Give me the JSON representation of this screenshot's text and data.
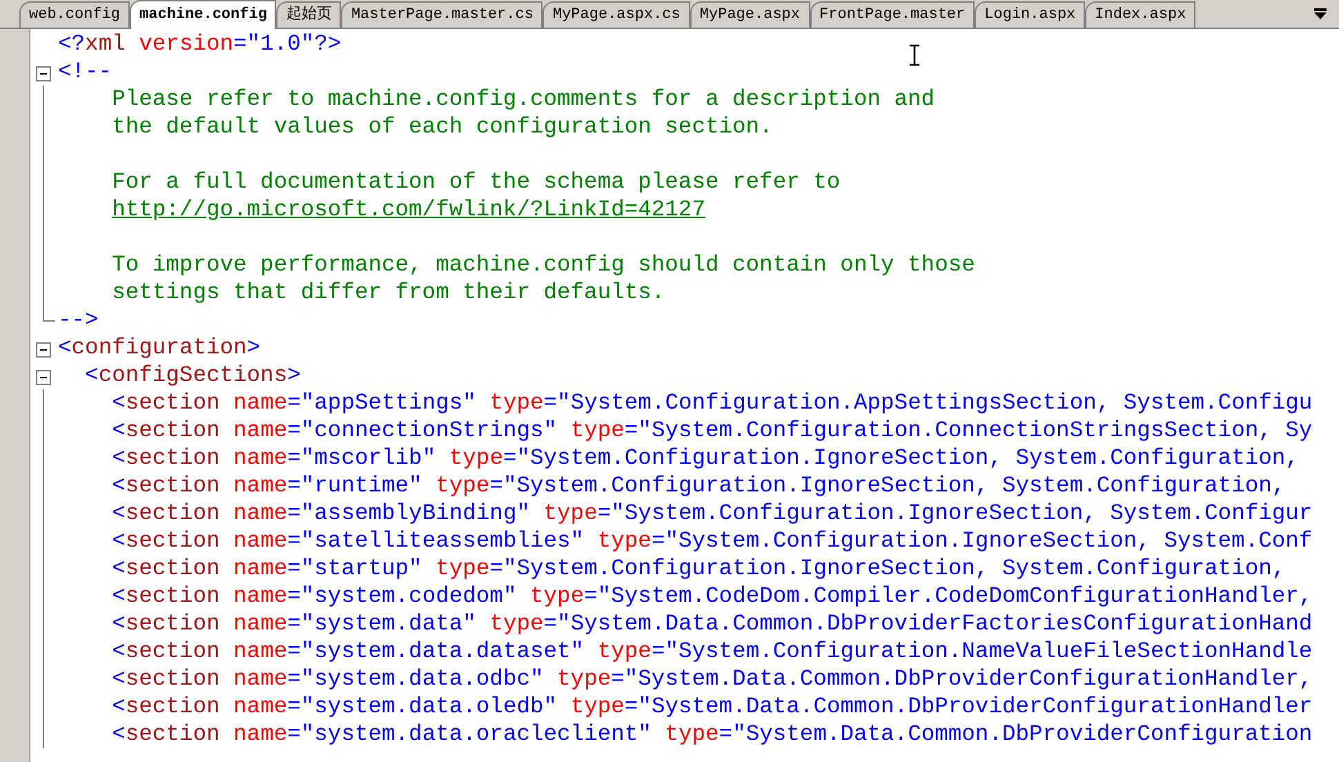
{
  "tabs": [
    {
      "label": "web.config",
      "selected": false
    },
    {
      "label": "machine.config",
      "selected": true
    },
    {
      "label": "起始页",
      "selected": false
    },
    {
      "label": "MasterPage.master.cs",
      "selected": false
    },
    {
      "label": "MyPage.aspx.cs",
      "selected": false
    },
    {
      "label": "MyPage.aspx",
      "selected": false
    },
    {
      "label": "FrontPage.master",
      "selected": false
    },
    {
      "label": "Login.aspx",
      "selected": false
    },
    {
      "label": "Index.aspx",
      "selected": false
    }
  ],
  "lines": [
    {
      "tokens": [
        {
          "kind": "bracket",
          "text": "<?"
        },
        {
          "kind": "tag",
          "text": "xml"
        },
        {
          "kind": "attr",
          "text": " version"
        },
        {
          "kind": "value",
          "text": "=\"1.0\""
        },
        {
          "kind": "bracket",
          "text": "?>"
        }
      ]
    },
    {
      "collapse_box": true,
      "tokens": [
        {
          "kind": "bracket",
          "text": "<!--"
        }
      ]
    },
    {
      "fold_line": true,
      "tokens": [
        {
          "kind": "comment",
          "text": "    Please refer to machine.config.comments for a description and"
        }
      ]
    },
    {
      "fold_line": true,
      "tokens": [
        {
          "kind": "comment",
          "text": "    the default values of each configuration section."
        }
      ]
    },
    {
      "fold_line": true
    },
    {
      "fold_line": true,
      "tokens": [
        {
          "kind": "comment",
          "text": "    For a full documentation of the schema please refer to"
        }
      ]
    },
    {
      "fold_line": true,
      "tokens": [
        {
          "kind": "link",
          "text": "http://go.microsoft.com/fwlink/?LinkId=42127"
        }
      ]
    },
    {
      "fold_line": true
    },
    {
      "fold_line": true,
      "tokens": [
        {
          "kind": "comment",
          "text": "    To improve performance, machine.config should contain only those"
        }
      ]
    },
    {
      "fold_line": true,
      "tokens": [
        {
          "kind": "comment",
          "text": "    settings that differ from their defaults."
        }
      ]
    },
    {
      "fold_end": true,
      "tokens": [
        {
          "kind": "bracket",
          "text": "-->"
        }
      ]
    },
    {
      "collapse_box": true,
      "tokens": [
        {
          "kind": "bracket",
          "text": "<"
        },
        {
          "kind": "tag",
          "text": "configuration"
        },
        {
          "kind": "bracket",
          "text": ">"
        }
      ]
    },
    {
      "collapse_box": true,
      "tokens": [
        {
          "kind": "bracket",
          "text": "  <"
        },
        {
          "kind": "tag",
          "text": "configSections"
        },
        {
          "kind": "bracket",
          "text": ">"
        }
      ]
    },
    {
      "fold_line": true,
      "tokens": [
        {
          "kind": "bracket",
          "text": "    <"
        },
        {
          "kind": "tag",
          "text": "section"
        },
        {
          "kind": "attr",
          "text": " name"
        },
        {
          "kind": "value",
          "text": "=\"appSettings\""
        },
        {
          "kind": "attr",
          "text": " type"
        },
        {
          "kind": "value",
          "text": "=\"System.Configuration.AppSettingsSection, System.Configu"
        }
      ]
    },
    {
      "fold_line": true,
      "tokens": [
        {
          "kind": "bracket",
          "text": "    <"
        },
        {
          "kind": "tag",
          "text": "section"
        },
        {
          "kind": "attr",
          "text": " name"
        },
        {
          "kind": "value",
          "text": "=\"connectionStrings\""
        },
        {
          "kind": "attr",
          "text": " type"
        },
        {
          "kind": "value",
          "text": "=\"System.Configuration.ConnectionStringsSection, Sy"
        }
      ]
    },
    {
      "fold_line": true,
      "tokens": [
        {
          "kind": "bracket",
          "text": "    <"
        },
        {
          "kind": "tag",
          "text": "section"
        },
        {
          "kind": "attr",
          "text": " name"
        },
        {
          "kind": "value",
          "text": "=\"mscorlib\""
        },
        {
          "kind": "attr",
          "text": " type"
        },
        {
          "kind": "value",
          "text": "=\"System.Configuration.IgnoreSection, System.Configuration,"
        }
      ]
    },
    {
      "fold_line": true,
      "tokens": [
        {
          "kind": "bracket",
          "text": "    <"
        },
        {
          "kind": "tag",
          "text": "section"
        },
        {
          "kind": "attr",
          "text": " name"
        },
        {
          "kind": "value",
          "text": "=\"runtime\""
        },
        {
          "kind": "attr",
          "text": " type"
        },
        {
          "kind": "value",
          "text": "=\"System.Configuration.IgnoreSection, System.Configuration,"
        }
      ]
    },
    {
      "fold_line": true,
      "tokens": [
        {
          "kind": "bracket",
          "text": "    <"
        },
        {
          "kind": "tag",
          "text": "section"
        },
        {
          "kind": "attr",
          "text": " name"
        },
        {
          "kind": "value",
          "text": "=\"assemblyBinding\""
        },
        {
          "kind": "attr",
          "text": " type"
        },
        {
          "kind": "value",
          "text": "=\"System.Configuration.IgnoreSection, System.Configur"
        }
      ]
    },
    {
      "fold_line": true,
      "tokens": [
        {
          "kind": "bracket",
          "text": "    <"
        },
        {
          "kind": "tag",
          "text": "section"
        },
        {
          "kind": "attr",
          "text": " name"
        },
        {
          "kind": "value",
          "text": "=\"satelliteassemblies\""
        },
        {
          "kind": "attr",
          "text": " type"
        },
        {
          "kind": "value",
          "text": "=\"System.Configuration.IgnoreSection, System.Conf"
        }
      ]
    },
    {
      "fold_line": true,
      "tokens": [
        {
          "kind": "bracket",
          "text": "    <"
        },
        {
          "kind": "tag",
          "text": "section"
        },
        {
          "kind": "attr",
          "text": " name"
        },
        {
          "kind": "value",
          "text": "=\"startup\""
        },
        {
          "kind": "attr",
          "text": " type"
        },
        {
          "kind": "value",
          "text": "=\"System.Configuration.IgnoreSection, System.Configuration,"
        }
      ]
    },
    {
      "fold_line": true,
      "tokens": [
        {
          "kind": "bracket",
          "text": "    <"
        },
        {
          "kind": "tag",
          "text": "section"
        },
        {
          "kind": "attr",
          "text": " name"
        },
        {
          "kind": "value",
          "text": "=\"system.codedom\""
        },
        {
          "kind": "attr",
          "text": " type"
        },
        {
          "kind": "value",
          "text": "=\"System.CodeDom.Compiler.CodeDomConfigurationHandler,"
        }
      ]
    },
    {
      "fold_line": true,
      "tokens": [
        {
          "kind": "bracket",
          "text": "    <"
        },
        {
          "kind": "tag",
          "text": "section"
        },
        {
          "kind": "attr",
          "text": " name"
        },
        {
          "kind": "value",
          "text": "=\"system.data\""
        },
        {
          "kind": "attr",
          "text": " type"
        },
        {
          "kind": "value",
          "text": "=\"System.Data.Common.DbProviderFactoriesConfigurationHand"
        }
      ]
    },
    {
      "fold_line": true,
      "tokens": [
        {
          "kind": "bracket",
          "text": "    <"
        },
        {
          "kind": "tag",
          "text": "section"
        },
        {
          "kind": "attr",
          "text": " name"
        },
        {
          "kind": "value",
          "text": "=\"system.data.dataset\""
        },
        {
          "kind": "attr",
          "text": " type"
        },
        {
          "kind": "value",
          "text": "=\"System.Configuration.NameValueFileSectionHandle"
        }
      ]
    },
    {
      "fold_line": true,
      "tokens": [
        {
          "kind": "bracket",
          "text": "    <"
        },
        {
          "kind": "tag",
          "text": "section"
        },
        {
          "kind": "attr",
          "text": " name"
        },
        {
          "kind": "value",
          "text": "=\"system.data.odbc\""
        },
        {
          "kind": "attr",
          "text": " type"
        },
        {
          "kind": "value",
          "text": "=\"System.Data.Common.DbProviderConfigurationHandler,"
        }
      ]
    },
    {
      "fold_line": true,
      "tokens": [
        {
          "kind": "bracket",
          "text": "    <"
        },
        {
          "kind": "tag",
          "text": "section"
        },
        {
          "kind": "attr",
          "text": " name"
        },
        {
          "kind": "value",
          "text": "=\"system.data.oledb\""
        },
        {
          "kind": "attr",
          "text": " type"
        },
        {
          "kind": "value",
          "text": "=\"System.Data.Common.DbProviderConfigurationHandler"
        }
      ]
    },
    {
      "fold_line": true,
      "tokens": [
        {
          "kind": "bracket",
          "text": "    <"
        },
        {
          "kind": "tag",
          "text": "section"
        },
        {
          "kind": "attr",
          "text": " name"
        },
        {
          "kind": "value",
          "text": "=\"system.data.oracleclient\""
        },
        {
          "kind": "attr",
          "text": " type"
        },
        {
          "kind": "value",
          "text": "=\"System.Data.Common.DbProviderConfiguration"
        }
      ]
    }
  ]
}
